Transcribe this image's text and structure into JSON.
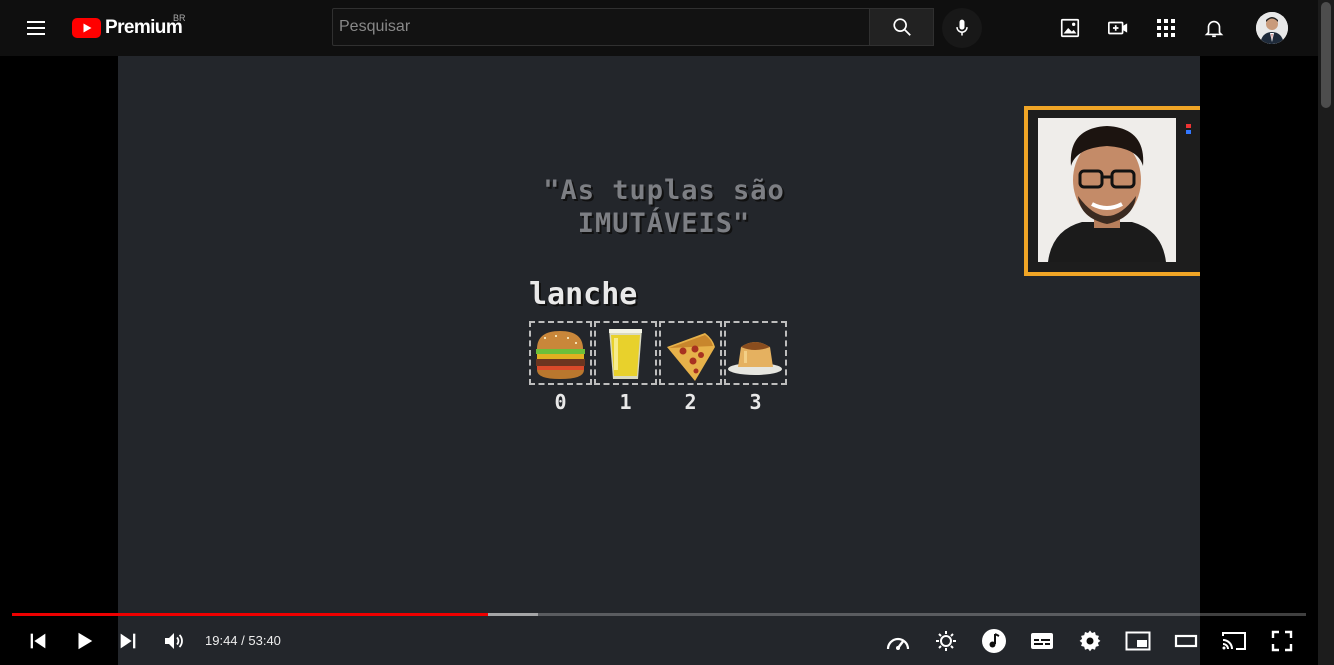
{
  "header": {
    "logo_text": "Premium",
    "region": "BR",
    "search_placeholder": "Pesquisar",
    "icons": [
      "menu-icon",
      "search-icon",
      "microphone-icon",
      "create-post-icon",
      "create-video-icon",
      "apps-icon",
      "notifications-icon",
      "avatar"
    ]
  },
  "video": {
    "slide_title": "\"As tuplas são\nIMUTÁVEIS\"",
    "variable_name": "lanche",
    "items": [
      {
        "icon": "hamburger-icon",
        "index": "0"
      },
      {
        "icon": "drink-icon",
        "index": "1"
      },
      {
        "icon": "pizza-icon",
        "index": "2"
      },
      {
        "icon": "pudding-icon",
        "index": "3"
      }
    ]
  },
  "player": {
    "current_time": "19:44",
    "duration": "53:40",
    "time_display": "19:44 / 53:40",
    "progress_fraction": 0.3676,
    "buffered_fraction": 0.4062,
    "controls": [
      "previous-icon",
      "play-icon",
      "next-icon",
      "volume-icon",
      "speed-icon",
      "ambient-icon",
      "music-icon",
      "subtitles-icon",
      "settings-icon",
      "miniplayer-icon",
      "theater-icon",
      "cast-icon",
      "fullscreen-icon"
    ]
  },
  "colors": {
    "progress": "#ff0000",
    "accent_frame": "#f0a526",
    "video_bg": "#23262b"
  }
}
